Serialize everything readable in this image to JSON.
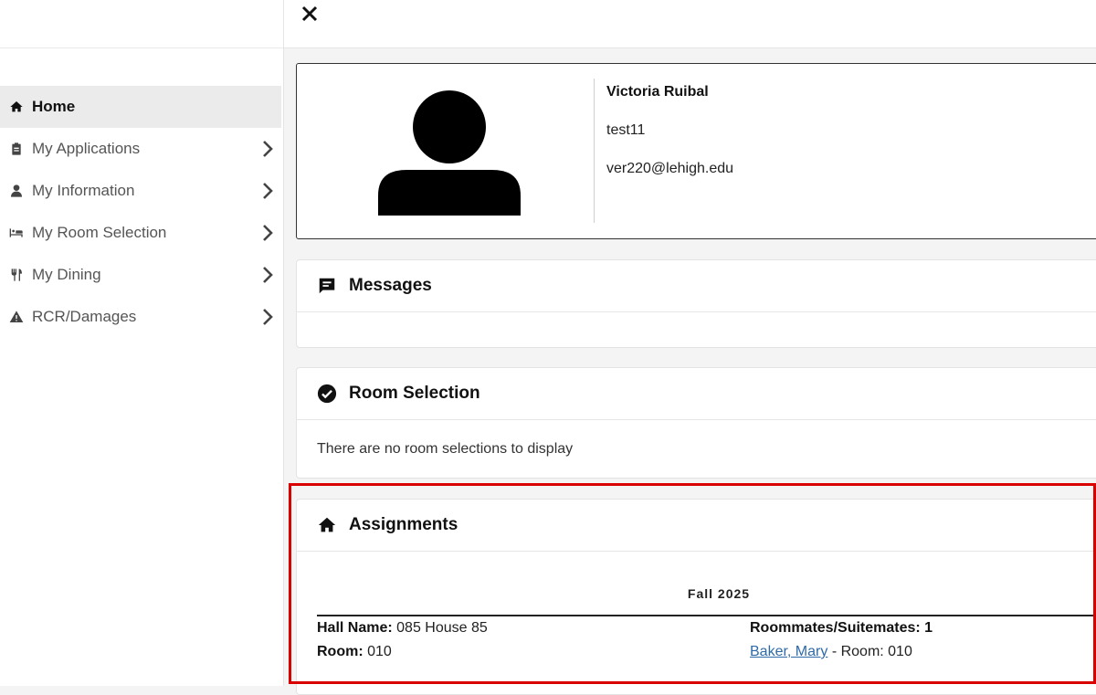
{
  "sidebar": {
    "items": [
      {
        "label": "Home",
        "icon": "home-icon",
        "active": true
      },
      {
        "label": "My Applications",
        "icon": "clipboard-icon"
      },
      {
        "label": "My Information",
        "icon": "user-icon"
      },
      {
        "label": "My Room Selection",
        "icon": "bed-icon"
      },
      {
        "label": "My Dining",
        "icon": "utensils-icon"
      },
      {
        "label": "RCR/Damages",
        "icon": "warning-icon"
      }
    ]
  },
  "profile": {
    "name": "Victoria Ruibal",
    "username": "test11",
    "email": "ver220@lehigh.edu"
  },
  "messages": {
    "title": "Messages"
  },
  "room_selection": {
    "title": "Room Selection",
    "empty_text": "There are no room selections to display"
  },
  "assignments": {
    "title": "Assignments",
    "term": "Fall 2025",
    "hall_label": "Hall Name:",
    "hall_value": "085 House 85",
    "room_label": "Room:",
    "room_value": "010",
    "roommates_label": "Roommates/Suitemates: 1",
    "roommate_name": "Baker, Mary",
    "roommate_room": "- Room: 010"
  },
  "colors": {
    "highlight": "#d90000",
    "link": "#2f6aa8",
    "active_nav_bg": "#ebebeb"
  }
}
